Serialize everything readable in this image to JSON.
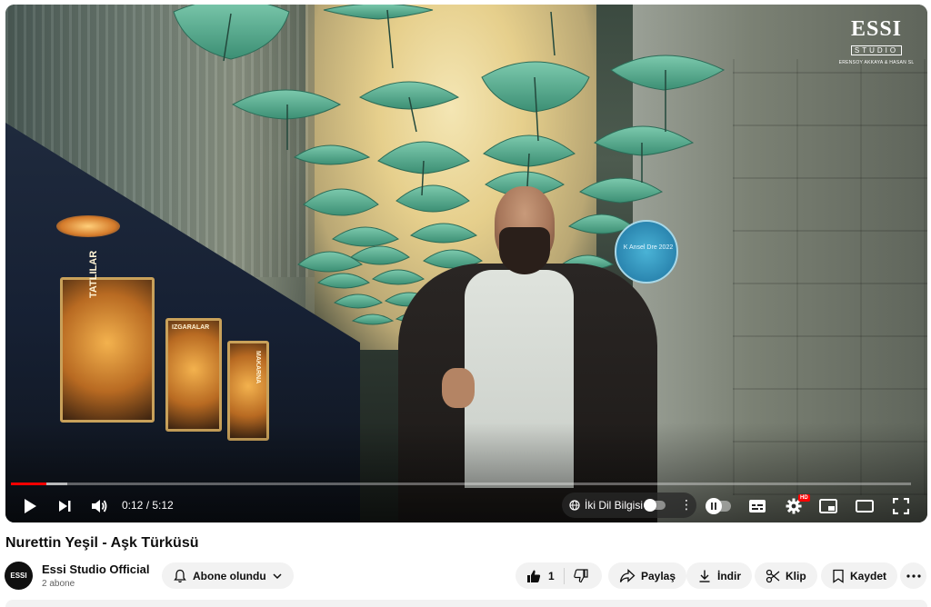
{
  "video": {
    "logo_main": "ESSI",
    "logo_sub": "STUDIO",
    "logo_credit": "ERENSOY AKKAYA & HASAN SL",
    "sign_text": "K Ansel Dre 2022",
    "poster_left": "TATLILAR",
    "poster_mid": "IZGARALAR",
    "poster_right": "MAKARNA",
    "progress": 0.039
  },
  "controls": {
    "time_current": "0:12",
    "time_total": "5:12",
    "time_sep": " / ",
    "subtitle_label": "İki Dil Bilgisi",
    "hd_badge": "HD",
    "icons": [
      "play-icon",
      "next-icon",
      "volume-icon",
      "subtitles-icon",
      "settings-icon",
      "miniplayer-icon",
      "theater-icon",
      "fullscreen-icon"
    ]
  },
  "info": {
    "title": "Nurettin Yeşil - Aşk Türküsü",
    "channel": "Essi Studio Official",
    "subscribers": "2 abone",
    "avatar_text": "ESSI",
    "subscribe_label": "Abone olundu",
    "like_count": "1",
    "share_label": "Paylaş",
    "download_label": "İndir",
    "clip_label": "Klip",
    "save_label": "Kaydet"
  },
  "colors": {
    "accent": "#ff0000",
    "button_bg": "#f2f2f2",
    "text": "#0f0f0f",
    "muted": "#606060"
  }
}
